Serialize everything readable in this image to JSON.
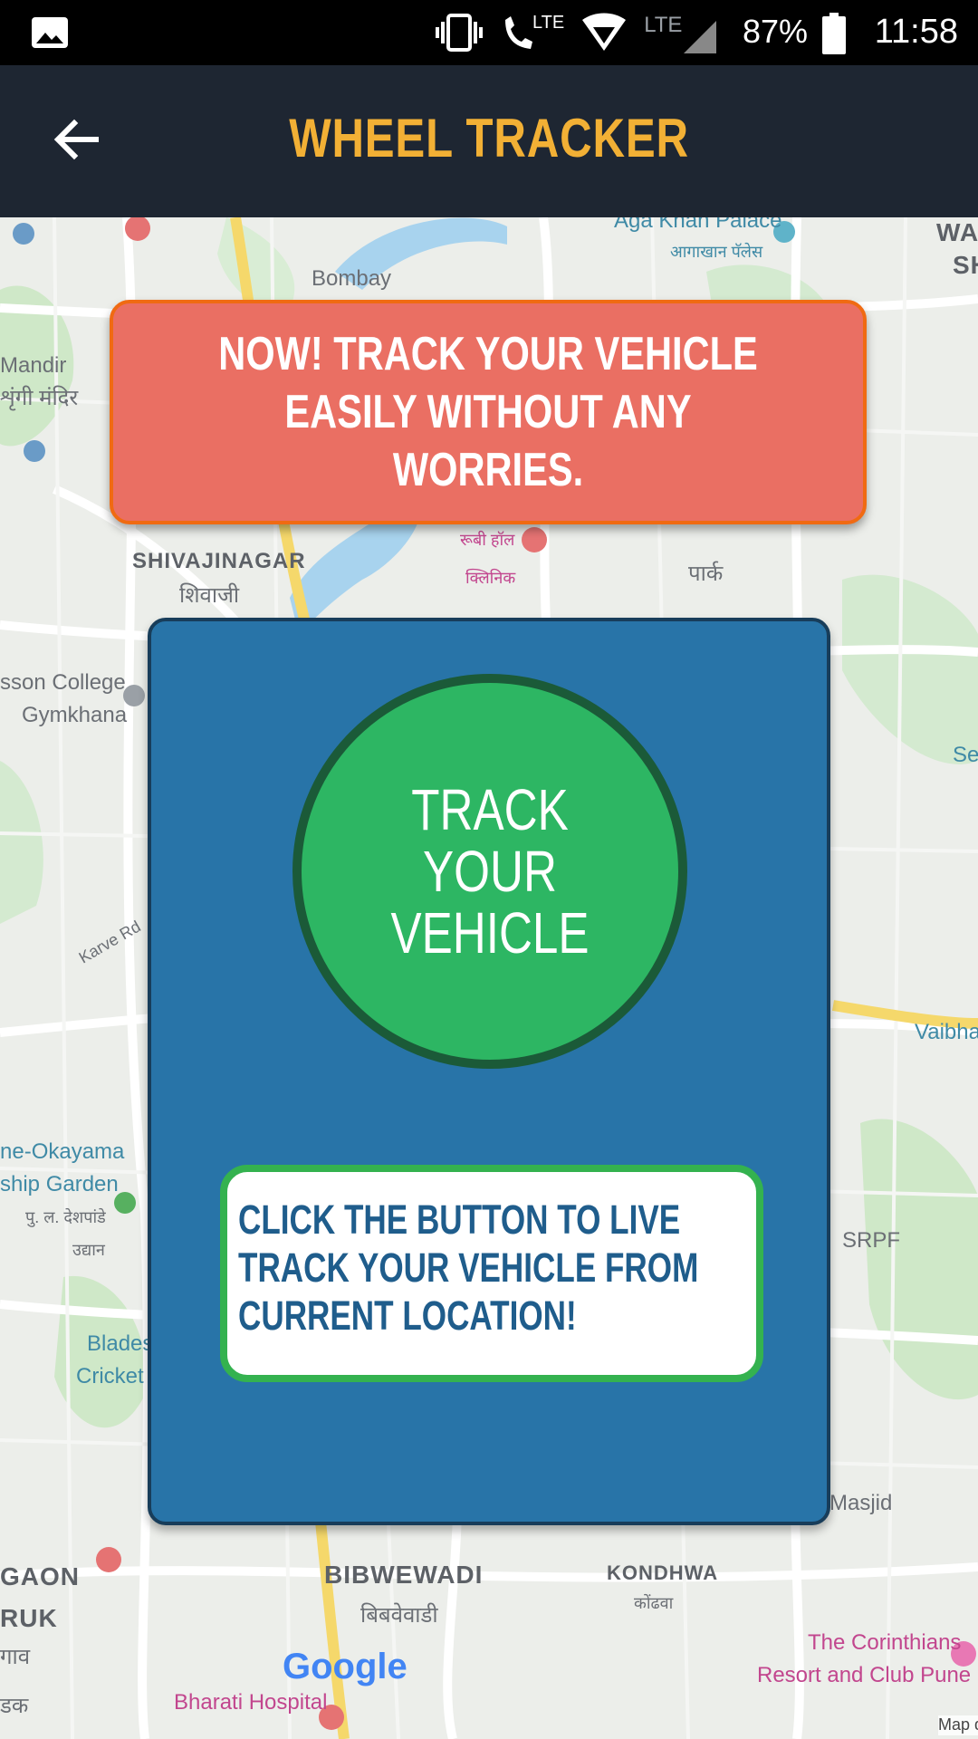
{
  "status_bar": {
    "lte_call": "LTE",
    "lte_signal": "LTE",
    "battery": "87%",
    "time": "11:58",
    "icons": [
      "gallery-icon",
      "vibrate-icon",
      "volte-call-icon",
      "wifi-icon",
      "signal-icon",
      "battery-icon"
    ]
  },
  "app_bar": {
    "title": "WHEEL TRACKER",
    "back_icon": "arrow-left-icon"
  },
  "banner": {
    "text": "NOW! TRACK YOUR VEHICLE\nEASILY WITHOUT ANY WORRIES."
  },
  "track_button": {
    "label": "TRACK YOUR\nVEHICLE"
  },
  "info": {
    "text": "CLICK THE BUTTON TO LIVE TRACK YOUR VEHICLE FROM CURRENT LOCATION!"
  },
  "map": {
    "labels": {
      "aga_khan": "Aga Khan Palace",
      "aga_khan_mr": "आगाखान पॅलेस",
      "bombay": "Bombay",
      "wad": "WAD",
      "sh": "SH",
      "mandir": "Mandir",
      "mandir_mr": "शृंगी मंदिर",
      "shivajinagar": "SHIVAJINAGAR",
      "shivajinagar_mr": "शिवाजी",
      "ruby_hall": "रूबी हॉल",
      "clinic": "क्लिनिक",
      "park": "पार्क",
      "college": "sson College",
      "gymkhana": "Gymkhana",
      "karve": "Karve Rd",
      "okayama": "ne-Okayama",
      "ship_garden": "ship Garden",
      "pu_la": "पु. ल. देशपांडे",
      "udyan": "उद्यान",
      "blades": "Blades",
      "cricket": "Cricket I",
      "srpf": "SRPF",
      "vaibhav": "Vaibha",
      "masjid": "Masjid",
      "gaon": "GAON",
      "ruk": "RUK",
      "gaon_mr": "गाव",
      "kak": "डक",
      "bibwewadi": "BIBWEWADI",
      "bibwewadi_mr": "बिबवेवाडी",
      "kondhwa": "KONDHWA",
      "kondhwa_mr": "कोंढवा",
      "corinthians": "The Corinthians",
      "resort": "Resort and Club Pune",
      "bharati": "Bharati Hospital",
      "google": "Google",
      "map_data": "Map d",
      "sea": "Sea"
    }
  }
}
